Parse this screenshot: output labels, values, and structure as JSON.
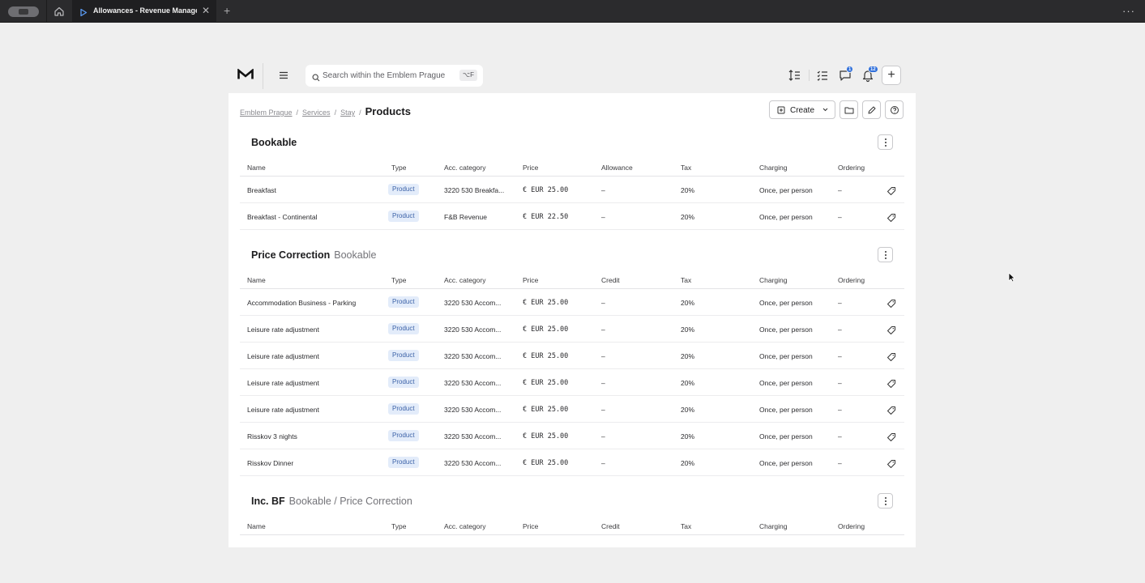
{
  "browser": {
    "tab_title": "Allowances - Revenue Management",
    "close_glyph": "✕",
    "new_tab_glyph": "+",
    "menu_glyph": "···"
  },
  "header": {
    "search_placeholder": "Search within the Emblem Prague",
    "search_shortcut": "⌥F",
    "chat_badge": "1",
    "notifications_badge": "12",
    "add_glyph": "+"
  },
  "breadcrumb": {
    "items": [
      "Emblem Prague",
      "Services",
      "Stay"
    ],
    "separator": "/",
    "current": "Products"
  },
  "toolbar": {
    "create_label": "Create"
  },
  "sections": [
    {
      "title": "Bookable",
      "subtitle": "",
      "columns": [
        "Name",
        "Type",
        "Acc. category",
        "Price",
        "Allowance",
        "Tax",
        "Charging",
        "Ordering"
      ],
      "rows": [
        {
          "name": "Breakfast",
          "type": "Product",
          "acc_category": "3220 530 Breakfa...",
          "price": "€ EUR 25.00",
          "col5": "–",
          "tax": "20%",
          "charging": "Once, per person",
          "ordering": "–"
        },
        {
          "name": "Breakfast - Continental",
          "type": "Product",
          "acc_category": "F&B Revenue",
          "price": "€ EUR 22.50",
          "col5": "–",
          "tax": "20%",
          "charging": "Once, per person",
          "ordering": "–"
        }
      ]
    },
    {
      "title": "Price Correction",
      "subtitle": "Bookable",
      "columns": [
        "Name",
        "Type",
        "Acc. category",
        "Price",
        "Credit",
        "Tax",
        "Charging",
        "Ordering"
      ],
      "rows": [
        {
          "name": "Accommodation Business - Parking",
          "type": "Product",
          "acc_category": "3220 530 Accom...",
          "price": "€ EUR 25.00",
          "col5": "–",
          "tax": "20%",
          "charging": "Once, per person",
          "ordering": "–"
        },
        {
          "name": "Leisure rate adjustment",
          "type": "Product",
          "acc_category": "3220 530 Accom...",
          "price": "€ EUR 25.00",
          "col5": "–",
          "tax": "20%",
          "charging": "Once, per person",
          "ordering": "–"
        },
        {
          "name": "Leisure rate adjustment",
          "type": "Product",
          "acc_category": "3220 530 Accom...",
          "price": "€ EUR 25.00",
          "col5": "–",
          "tax": "20%",
          "charging": "Once, per person",
          "ordering": "–"
        },
        {
          "name": "Leisure rate adjustment",
          "type": "Product",
          "acc_category": "3220 530 Accom...",
          "price": "€ EUR 25.00",
          "col5": "–",
          "tax": "20%",
          "charging": "Once, per person",
          "ordering": "–"
        },
        {
          "name": "Leisure rate adjustment",
          "type": "Product",
          "acc_category": "3220 530 Accom...",
          "price": "€ EUR 25.00",
          "col5": "–",
          "tax": "20%",
          "charging": "Once, per person",
          "ordering": "–"
        },
        {
          "name": "Risskov 3 nights",
          "type": "Product",
          "acc_category": "3220 530 Accom...",
          "price": "€ EUR 25.00",
          "col5": "–",
          "tax": "20%",
          "charging": "Once, per person",
          "ordering": "–"
        },
        {
          "name": "Risskov Dinner",
          "type": "Product",
          "acc_category": "3220 530 Accom...",
          "price": "€ EUR 25.00",
          "col5": "–",
          "tax": "20%",
          "charging": "Once, per person",
          "ordering": "–"
        }
      ]
    },
    {
      "title": "Inc. BF",
      "subtitle": "Bookable / Price Correction",
      "columns": [
        "Name",
        "Type",
        "Acc. category",
        "Price",
        "Credit",
        "Tax",
        "Charging",
        "Ordering"
      ],
      "rows": []
    }
  ],
  "icons": {
    "tab_icon": "play-icon",
    "row_action": "tag-icon",
    "header": [
      "sort-icon",
      "checklist-icon",
      "chat-icon",
      "bell-icon"
    ],
    "toolbar": [
      "folder-icon",
      "pencil-icon",
      "help-icon"
    ]
  },
  "colors": {
    "accent": "#2f6fdb",
    "tag_bg": "#e3ecfa",
    "tag_text": "#3d63a8"
  }
}
